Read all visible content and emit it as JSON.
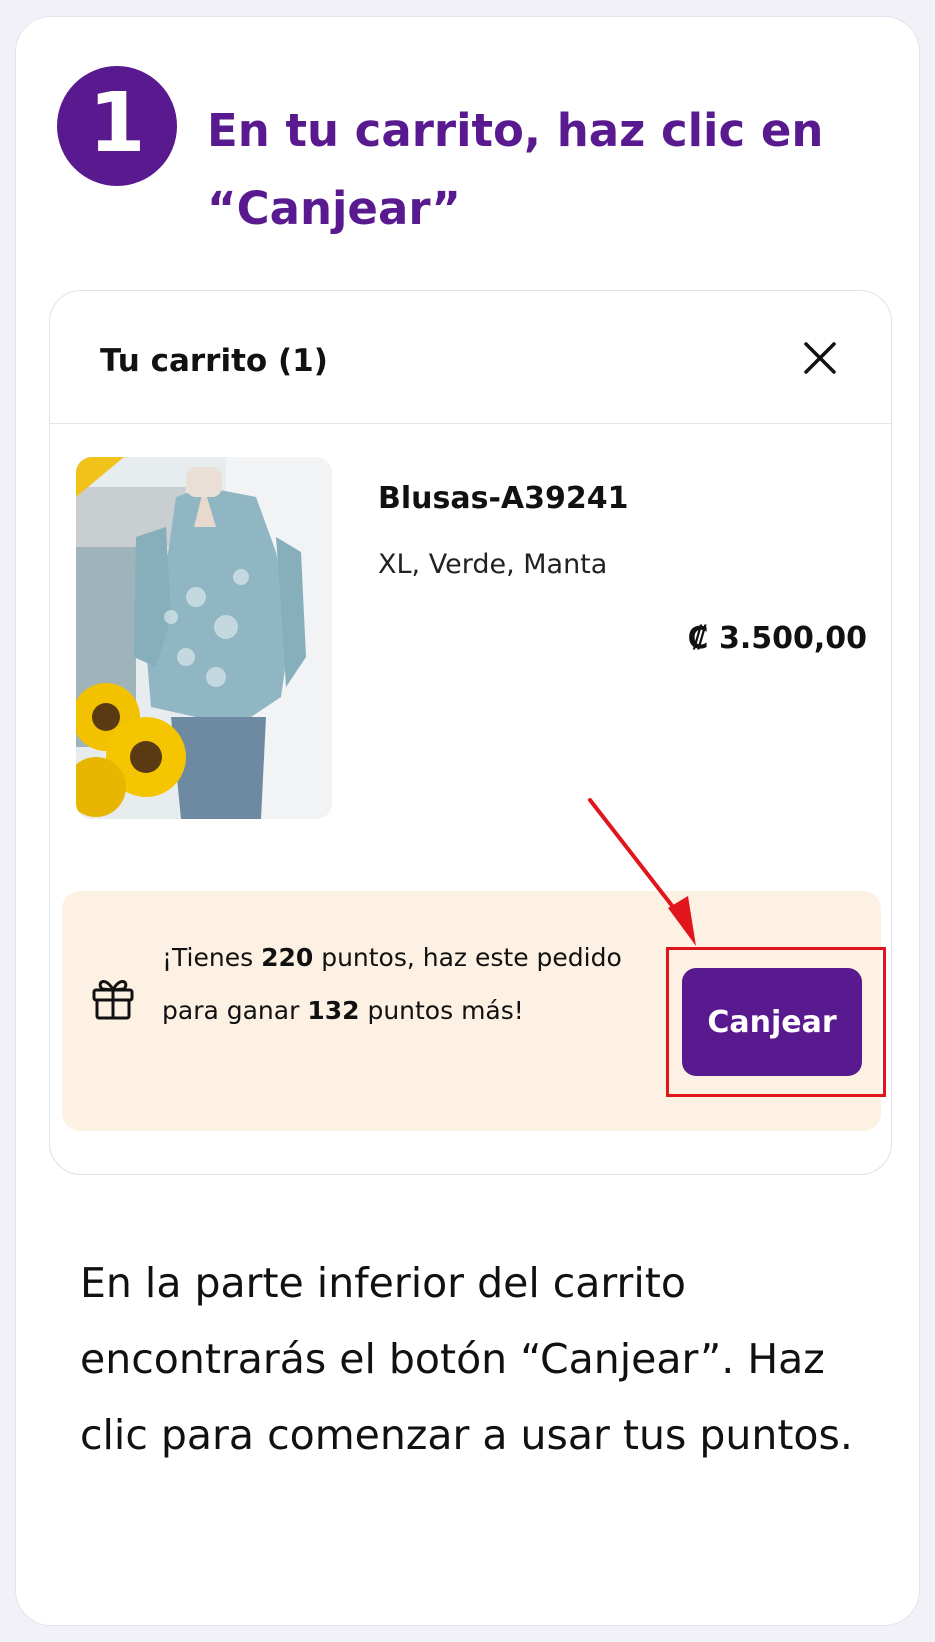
{
  "step": {
    "number": "1",
    "title": "En tu carrito, haz clic en “Canjear”"
  },
  "cart": {
    "title": "Tu carrito (1)",
    "close_icon": "close-icon",
    "product": {
      "name": "Blusas-A39241",
      "variant": "XL, Verde, Manta",
      "price": "₡ 3.500,00"
    },
    "points": {
      "icon": "gift-icon",
      "text_prefix": "¡Tienes ",
      "points_have": "220",
      "text_mid": " puntos, haz este pedido para ganar ",
      "points_earn": "132",
      "text_suffix": " puntos más!",
      "button_label": "Canjear"
    }
  },
  "description": "En la parte inferior del carrito encontrarás el botón “Canjear”. Haz clic para comenzar a usar tus puntos.",
  "colors": {
    "brand_purple": "#5a1a8f",
    "highlight_red": "#e0161c",
    "points_bg": "#fdf1e4"
  }
}
